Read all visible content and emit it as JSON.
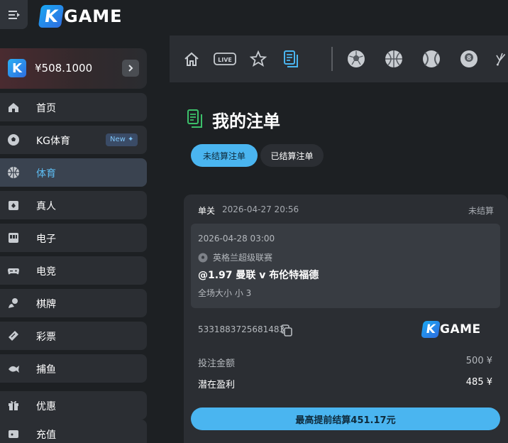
{
  "header": {
    "logo_letter": "K",
    "logo_word": "GAME"
  },
  "sidebar": {
    "balance": "¥508.1000",
    "items": [
      {
        "label": "首页",
        "icon": "home-icon"
      },
      {
        "label": "KG体育",
        "icon": "soccer-ball-icon",
        "badge": "New"
      },
      {
        "label": "体育",
        "icon": "basketball-icon",
        "active": true
      },
      {
        "label": "真人",
        "icon": "playing-cards-icon"
      },
      {
        "label": "电子",
        "icon": "slot-machine-icon"
      },
      {
        "label": "电竞",
        "icon": "gamepad-icon"
      },
      {
        "label": "棋牌",
        "icon": "chess-piece-icon"
      },
      {
        "label": "彩票",
        "icon": "lottery-ticket-icon"
      },
      {
        "label": "捕鱼",
        "icon": "fish-icon"
      },
      {
        "label": "优惠",
        "icon": "gift-icon"
      },
      {
        "label": "充值",
        "icon": "wallet-icon"
      }
    ]
  },
  "sport_bar": {
    "live_label": "LIVE"
  },
  "main": {
    "title": "我的注单",
    "tabs": [
      {
        "label": "未结算注单",
        "active": true
      },
      {
        "label": "已结算注单",
        "active": false
      }
    ],
    "bet": {
      "type": "单关",
      "placed_time": "2026-04-27 20:56",
      "status": "未结算",
      "match_time": "2026-04-28 03:00",
      "league": "英格兰超级联赛",
      "selection": "@1.97 曼联 v 布伦特福德",
      "market": "全场大小 小 3",
      "bet_id": "5331883725681483",
      "stake_label": "投注金额",
      "stake_value": "500 ¥",
      "profit_label": "潜在盈利",
      "profit_value": "485 ¥",
      "cashout_label": "最高提前结算451.17元"
    }
  },
  "colors": {
    "accent": "#4ab5f0",
    "background": "#1d2023",
    "panel": "#2b2e33",
    "title_icon": "#3cc06a"
  }
}
